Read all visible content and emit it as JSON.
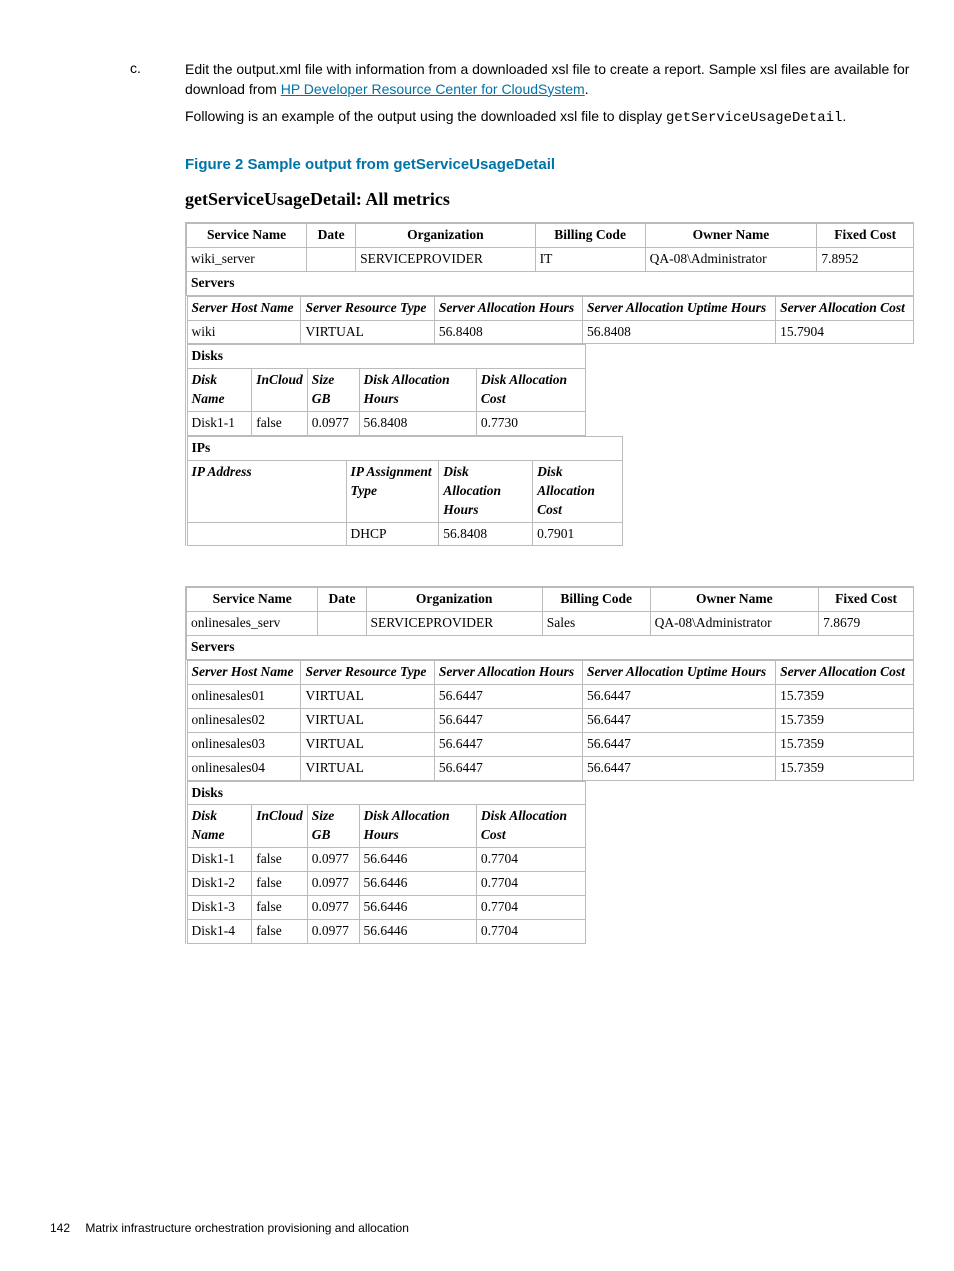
{
  "list": {
    "marker": "c.",
    "paragraph1_a": "Edit the output.xml file with information from a downloaded xsl file to create a report. Sample xsl files are available for download from ",
    "link_text": "HP Developer Resource Center for CloudSystem",
    "paragraph1_b": ".",
    "paragraph2": "Following is an example of the output using the downloaded xsl file to display ",
    "code": "getServiceUsageDetail",
    "paragraph2_b": "."
  },
  "figure_title": "Figure 2 Sample output from getServiceUsageDetail",
  "report_title": "getServiceUsageDetail: All metrics",
  "headers": {
    "svc_name": "Service Name",
    "date": "Date",
    "org": "Organization",
    "billing": "Billing Code",
    "owner": "Owner Name",
    "fixed": "Fixed Cost",
    "servers": "Servers",
    "sh_name": "Server Host Name",
    "sr_type": "Server Resource Type",
    "sa_hours": "Server Allocation Hours",
    "sau_hours": "Server Allocation Uptime Hours",
    "sa_cost": "Server Allocation Cost",
    "disks": "Disks",
    "d_name": "Disk Name",
    "incloud": "InCloud",
    "size": "Size GB",
    "da_hours": "Disk Allocation Hours",
    "da_cost": "Disk Allocation Cost",
    "ips": "IPs",
    "ip_addr": "IP Address",
    "ip_type": "IP Assignment Type"
  },
  "block1": {
    "svc_name": "wiki_server",
    "date": "",
    "org": "SERVICEPROVIDER",
    "billing": "IT",
    "owner": "QA-08\\Administrator",
    "fixed": "7.8952",
    "servers": [
      {
        "host": "wiki",
        "type": "VIRTUAL",
        "hours": "56.8408",
        "uptime": "56.8408",
        "cost": "15.7904"
      }
    ],
    "disks": [
      {
        "name": "Disk1-1",
        "incloud": "false",
        "size": "0.0977",
        "hours": "56.8408",
        "cost": "0.7730"
      }
    ],
    "ips": [
      {
        "addr": "",
        "type": "DHCP",
        "hours": "56.8408",
        "cost": "0.7901"
      }
    ]
  },
  "block2": {
    "svc_name": "onlinesales_serv",
    "date": "",
    "org": "SERVICEPROVIDER",
    "billing": "Sales",
    "owner": "QA-08\\Administrator",
    "fixed": "7.8679",
    "servers": [
      {
        "host": "onlinesales01",
        "type": "VIRTUAL",
        "hours": "56.6447",
        "uptime": "56.6447",
        "cost": "15.7359"
      },
      {
        "host": "onlinesales02",
        "type": "VIRTUAL",
        "hours": "56.6447",
        "uptime": "56.6447",
        "cost": "15.7359"
      },
      {
        "host": "onlinesales03",
        "type": "VIRTUAL",
        "hours": "56.6447",
        "uptime": "56.6447",
        "cost": "15.7359"
      },
      {
        "host": "onlinesales04",
        "type": "VIRTUAL",
        "hours": "56.6447",
        "uptime": "56.6447",
        "cost": "15.7359"
      }
    ],
    "disks": [
      {
        "name": "Disk1-1",
        "incloud": "false",
        "size": "0.0977",
        "hours": "56.6446",
        "cost": "0.7704"
      },
      {
        "name": "Disk1-2",
        "incloud": "false",
        "size": "0.0977",
        "hours": "56.6446",
        "cost": "0.7704"
      },
      {
        "name": "Disk1-3",
        "incloud": "false",
        "size": "0.0977",
        "hours": "56.6446",
        "cost": "0.7704"
      },
      {
        "name": "Disk1-4",
        "incloud": "false",
        "size": "0.0977",
        "hours": "56.6446",
        "cost": "0.7704"
      }
    ]
  },
  "footer": {
    "page": "142",
    "text": "Matrix infrastructure orchestration provisioning and allocation"
  }
}
